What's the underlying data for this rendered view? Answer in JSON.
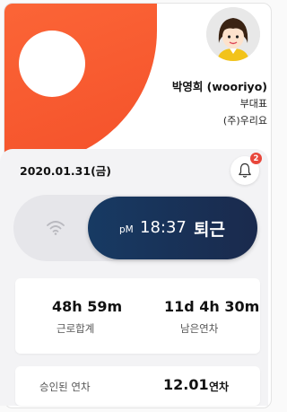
{
  "profile": {
    "name": "박영희 (wooriyo)",
    "title": "부대표",
    "company": "(주)우리요",
    "avatar_icon": "avatar-woman-icon"
  },
  "today": {
    "date": "2020.01.31(금)"
  },
  "notifications": {
    "icon": "bell-icon",
    "count": "2"
  },
  "clock": {
    "wifi_icon": "wifi-icon",
    "period": "pM",
    "time": "18:37",
    "status": "퇴근"
  },
  "stats": {
    "work_total_value": "48h 59m",
    "work_total_label": "근로합계",
    "leave_remaining_value": "11d 4h 30m",
    "leave_remaining_label": "남은연차"
  },
  "approved": {
    "label": "승인된 연차",
    "value": "12.01",
    "unit": "연차"
  },
  "colors": {
    "accent_orange": "#f4512a",
    "button_navy": "#1a2a4d",
    "badge_red": "#e8473b"
  }
}
